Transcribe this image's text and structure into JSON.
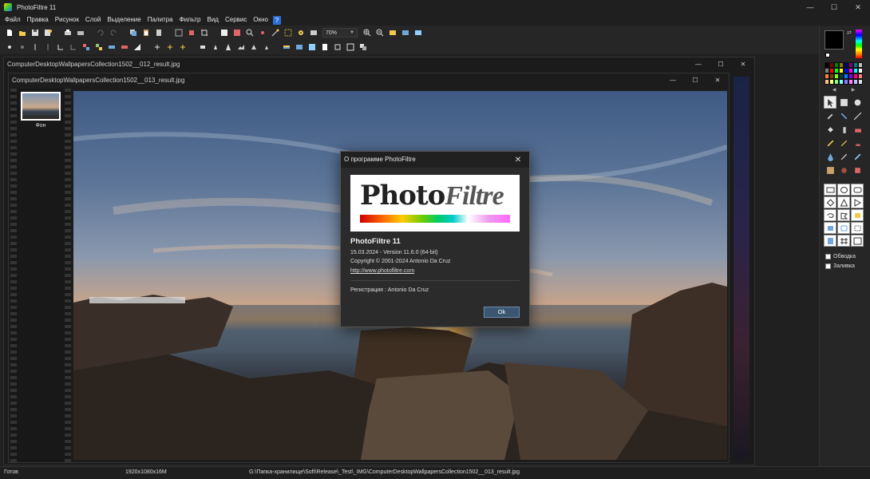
{
  "app": {
    "title": "PhotoFiltre 11"
  },
  "menu": [
    "Файл",
    "Правка",
    "Рисунок",
    "Слой",
    "Выделение",
    "Палитра",
    "Фильтр",
    "Вид",
    "Сервис",
    "Окно"
  ],
  "help_label": "?",
  "toolbar": {
    "zoom": "70%"
  },
  "documents": {
    "back_title": "ComputerDesktopWallpapersCollection1502__012_result.jpg",
    "front_title": "ComputerDesktopWallpapersCollection1502__013_result.jpg",
    "layer_name": "Фон"
  },
  "about": {
    "title": "О программе PhotoFiltre",
    "logo_text_a": "Pho",
    "logo_text_b": "to",
    "logo_text_c": "Filtre",
    "product": "PhotoFiltre 11",
    "version": "15.03.2024 - Version 11.6.0 (64-bit)",
    "copyright": "Copyright © 2001-2024  Antonio Da Cruz",
    "link": "http://www.photofiltre.com",
    "registration": "Регистрация : Antonio Da Cruz",
    "ok": "Ok"
  },
  "right_panel": {
    "outline_label": "Обводка",
    "fill_label": "Заливка",
    "palette": [
      "#000000",
      "#800000",
      "#008000",
      "#808000",
      "#000080",
      "#800080",
      "#008080",
      "#c0c0c0",
      "#808080",
      "#ff0000",
      "#00ff00",
      "#ffff00",
      "#0000ff",
      "#ff00ff",
      "#00ffff",
      "#ffffff",
      "#ff8040",
      "#804000",
      "#80ff00",
      "#004040",
      "#0080ff",
      "#8000ff",
      "#ff0080",
      "#ff8080",
      "#ffc080",
      "#ffff80",
      "#80ff80",
      "#80ffff",
      "#8080ff",
      "#ff80ff",
      "#c0c0ff",
      "#e0e0e0"
    ]
  },
  "status": {
    "ready": "Готов",
    "size": "1920x1080x16M",
    "path": "G:\\Папка-хранилище\\Soft\\Release\\_Test\\_IMG\\ComputerDesktopWallpapersCollection1502__013_result.jpg"
  }
}
